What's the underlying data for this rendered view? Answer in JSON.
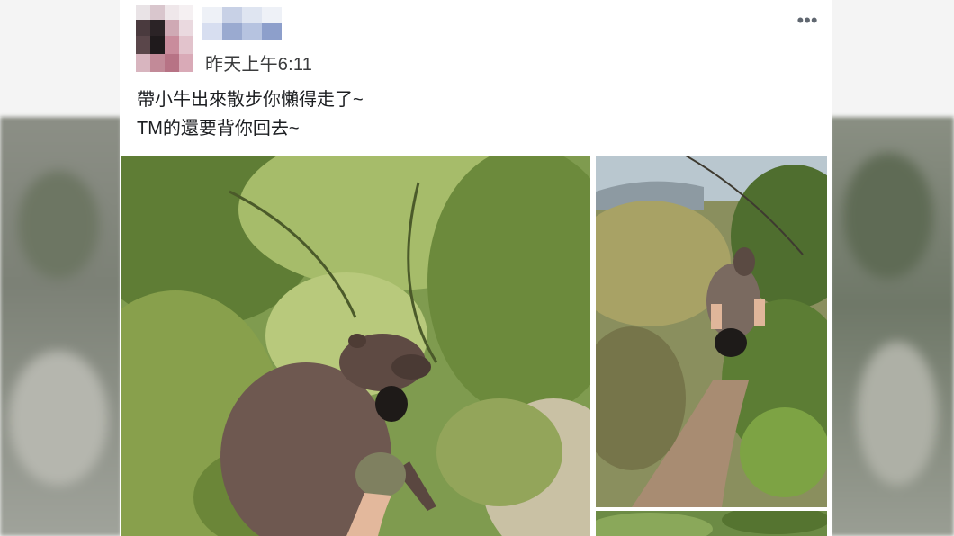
{
  "post": {
    "timestamp": "昨天上午6:11",
    "more_icon": "more-horizontal-icon",
    "more_glyph": "•••",
    "text_lines": [
      "帶小牛出來散步你懶得走了~",
      "TM的還要背你回去~"
    ]
  },
  "photos": [
    {
      "name": "photo-main",
      "subject": "person-carrying-calf-in-forest"
    },
    {
      "name": "photo-side",
      "subject": "person-carrying-calf-on-trail"
    },
    {
      "name": "photo-side-bottom",
      "subject": "foliage"
    }
  ],
  "colors": {
    "text": "#1c1e21",
    "meta": "#3a3b3c",
    "icon": "#606770",
    "card_bg": "#ffffff"
  }
}
